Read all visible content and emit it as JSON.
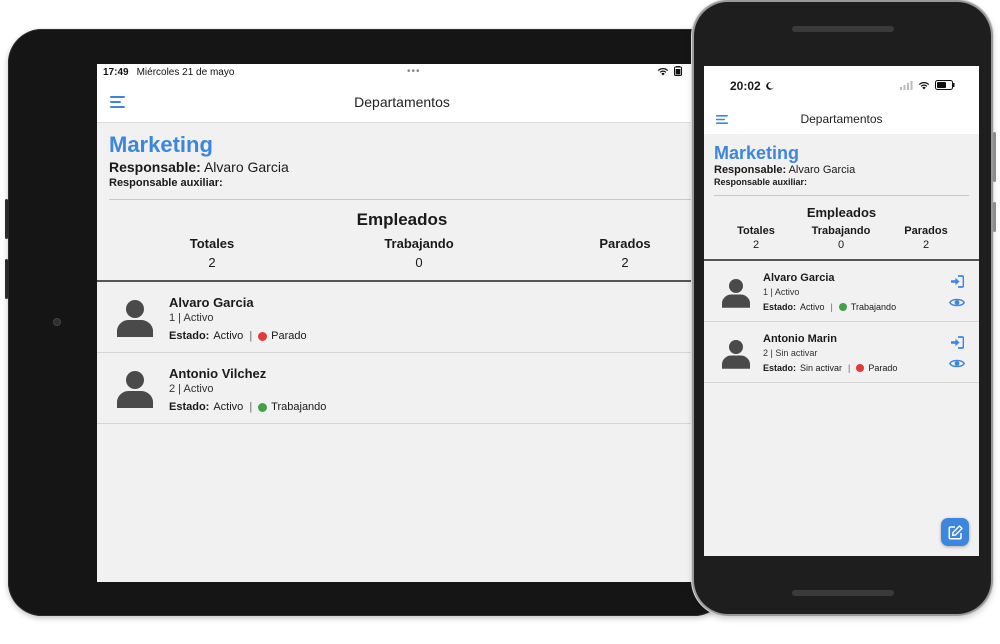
{
  "tablet": {
    "status": {
      "time": "17:49",
      "date": "Miércoles 21 de mayo",
      "dots": "•••"
    },
    "header": {
      "title": "Departamentos"
    },
    "department": {
      "name": "Marketing",
      "responsable_label": "Responsable:",
      "responsable_value": "Alvaro Garcia",
      "aux_label": "Responsable auxiliar:"
    },
    "empleados": {
      "title": "Empleados",
      "stats": [
        {
          "label": "Totales",
          "value": "2"
        },
        {
          "label": "Trabajando",
          "value": "0"
        },
        {
          "label": "Parados",
          "value": "2"
        }
      ]
    },
    "employees": [
      {
        "name": "Alvaro Garcia",
        "sub": "1 | Activo",
        "estado_label": "Estado:",
        "estado": "Activo",
        "sep": "|",
        "status": "Parado",
        "status_color": "#e53935"
      },
      {
        "name": "Antonio Vilchez",
        "sub": "2 | Activo",
        "estado_label": "Estado:",
        "estado": "Activo",
        "sep": "|",
        "status": "Trabajando",
        "status_color": "#43a047"
      }
    ]
  },
  "phone": {
    "status": {
      "time": "20:02"
    },
    "header": {
      "title": "Departamentos"
    },
    "department": {
      "name": "Marketing",
      "responsable_label": "Responsable:",
      "responsable_value": "Alvaro Garcia",
      "aux_label": "Responsable auxiliar:"
    },
    "empleados": {
      "title": "Empleados",
      "stats": [
        {
          "label": "Totales",
          "value": "2"
        },
        {
          "label": "Trabajando",
          "value": "0"
        },
        {
          "label": "Parados",
          "value": "2"
        }
      ]
    },
    "employees": [
      {
        "name": "Alvaro Garcia",
        "sub": "1 | Activo",
        "estado_label": "Estado:",
        "estado": "Activo",
        "sep": "|",
        "status": "Trabajando",
        "status_color": "#43a047"
      },
      {
        "name": "Antonio Marin",
        "sub": "2 | Sin activar",
        "estado_label": "Estado:",
        "estado": "Sin activar",
        "sep": "|",
        "status": "Parado",
        "status_color": "#e53935"
      }
    ]
  },
  "colors": {
    "accent": "#3d86e0",
    "working": "#43a047",
    "stopped": "#e53935",
    "avatar": "#4a4a4a"
  },
  "icons": [
    "menu-icon",
    "wifi-icon",
    "battery-icon",
    "signal-icon",
    "moon-icon",
    "person-icon",
    "sign-in-icon",
    "eye-icon",
    "edit-icon"
  ]
}
